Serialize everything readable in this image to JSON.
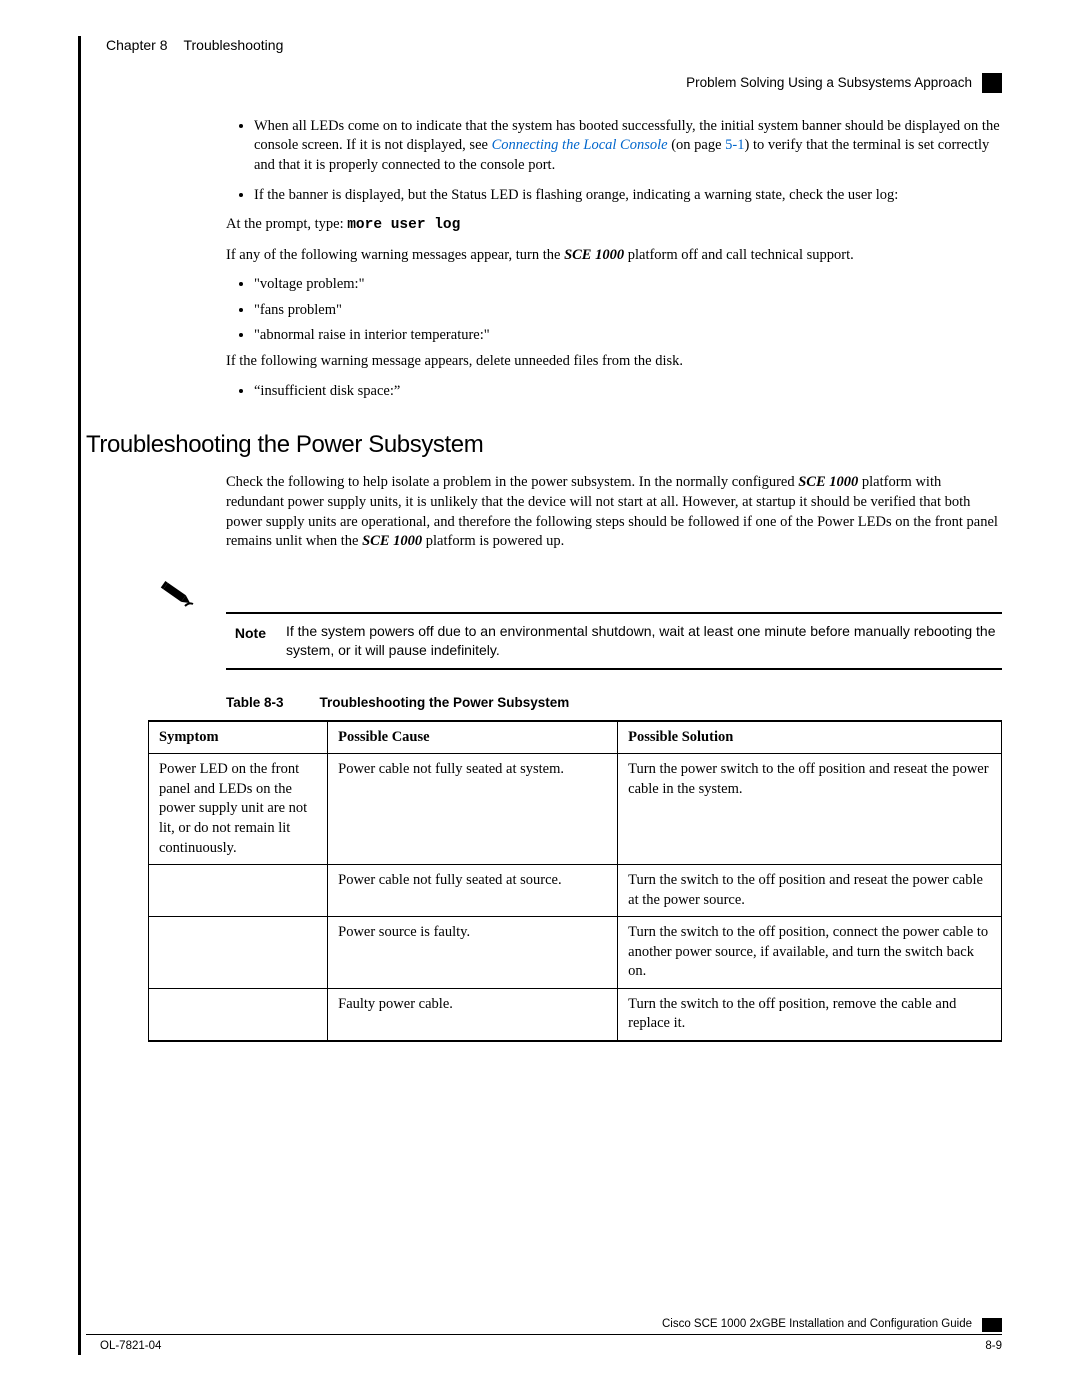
{
  "header": {
    "chapter": "Chapter 8",
    "title": "Troubleshooting",
    "section": "Problem Solving Using a Subsystems Approach"
  },
  "bullets1": {
    "i0a": "When all LEDs come on to indicate that the system has booted successfully, the initial system banner should be displayed on the console screen. If it is not displayed, see ",
    "link": "Connecting the Local Console",
    "i0b": " (on page ",
    "pageref": "5-1",
    "i0c": ") to verify that the terminal is set correctly and that it is properly connected to the console port.",
    "i1": "If the banner is displayed, but the Status LED is flashing orange, indicating a warning state, check the user log:"
  },
  "prompt_pre": "At the prompt, type: ",
  "prompt_cmd": "more user log",
  "warn_pre": "If any of the following warning messages appear, turn the ",
  "sce": "SCE 1000",
  "warn_post": " platform off and call technical support.",
  "warnings": {
    "i0": "\"voltage problem:\"",
    "i1": "\"fans problem\"",
    "i2": "\"abnormal raise in interior temperature:\""
  },
  "disk_msg": "If the following warning message appears, delete unneeded files from the disk.",
  "disk_bullet": "“insufficient disk space:”",
  "power": {
    "heading": "Troubleshooting the Power Subsystem",
    "p1a": "Check the following to help isolate a problem in the power subsystem. In the normally configured ",
    "p1b": " platform with redundant power supply units, it is unlikely that the device will not start at all. However, at startup it should be verified that both power supply units are operational, and therefore the following steps should be followed if one of the Power LEDs on the front panel remains unlit when the ",
    "p1c": " platform is powered up."
  },
  "note": {
    "label": "Note",
    "text": "If the system powers off due to an environmental shutdown, wait at least one minute before manually rebooting the system, or it will pause indefinitely."
  },
  "table": {
    "caption_no": "Table 8-3",
    "caption_title": "Troubleshooting the Power Subsystem",
    "head": {
      "c0": "Symptom",
      "c1": "Possible Cause",
      "c2": "Possible Solution"
    },
    "rows": {
      "r0": {
        "c0": "Power LED on the front panel and LEDs on the power supply unit are not lit, or do not remain lit continuously.",
        "c1": "Power cable not fully seated at system.",
        "c2": "Turn the power switch to the off position and reseat the power cable in the system."
      },
      "r1": {
        "c0": "",
        "c1": "Power cable not fully seated at source.",
        "c2": "Turn the switch to the off position and reseat the power cable at the power source."
      },
      "r2": {
        "c0": "",
        "c1": "Power source is faulty.",
        "c2": "Turn the switch to the off position, connect the power cable to another power source, if available, and turn the switch back on."
      },
      "r3": {
        "c0": "",
        "c1": "Faulty power cable.",
        "c2": "Turn the switch to the off position, remove the cable and replace it."
      }
    }
  },
  "footer": {
    "guide": "Cisco SCE 1000 2xGBE Installation and Configuration Guide",
    "doc": "OL-7821-04",
    "page": "8-9"
  }
}
